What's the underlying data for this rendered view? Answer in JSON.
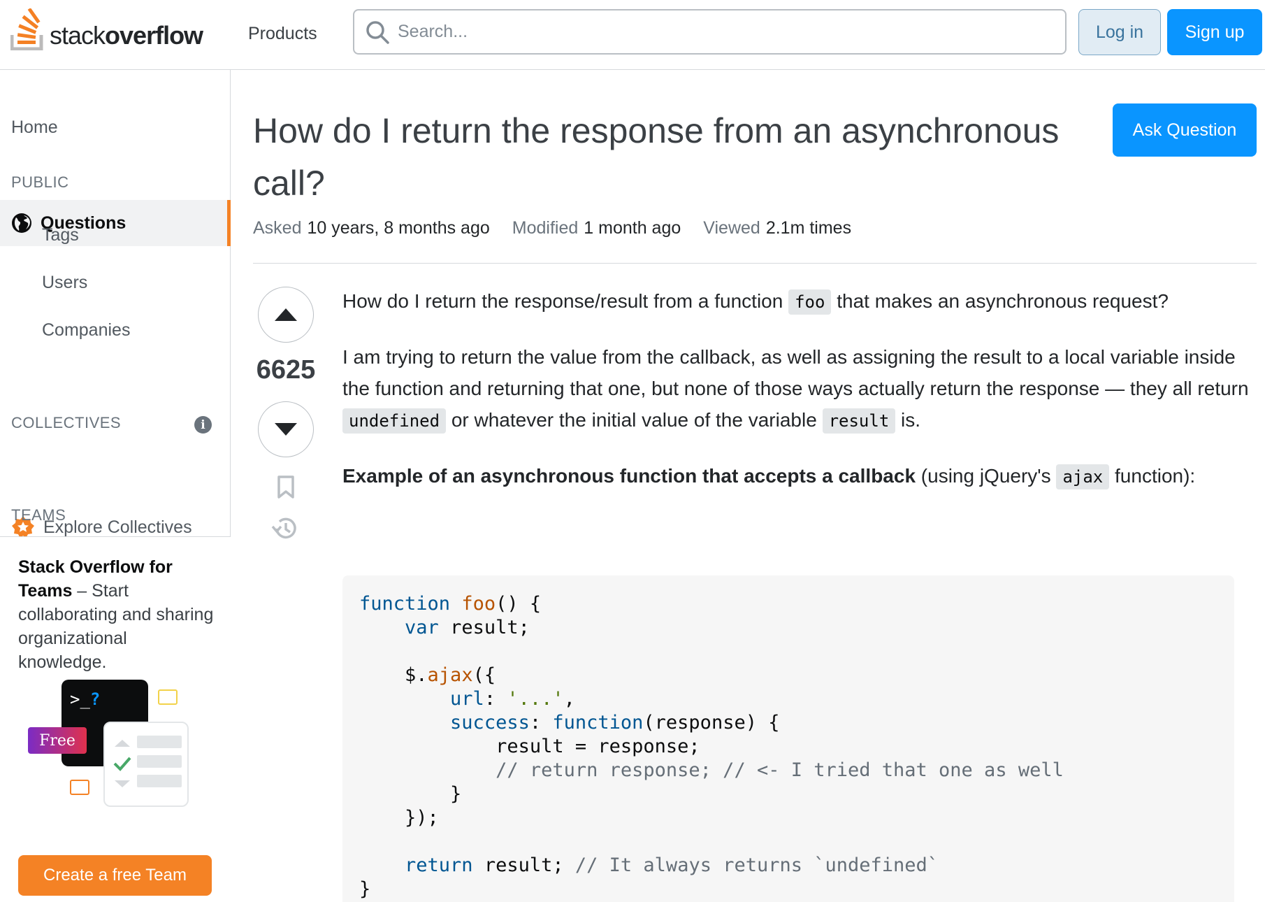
{
  "header": {
    "logo_text_light": "stack",
    "logo_text_bold": "overflow",
    "products_label": "Products",
    "search_placeholder": "Search...",
    "login_label": "Log in",
    "signup_label": "Sign up"
  },
  "sidebar": {
    "home": "Home",
    "public_heading": "PUBLIC",
    "questions": "Questions",
    "tags": "Tags",
    "users": "Users",
    "companies": "Companies",
    "collectives_heading": "COLLECTIVES",
    "explore_collectives": "Explore Collectives",
    "teams_heading": "TEAMS",
    "teams_promo_bold": "Stack Overflow for Teams",
    "teams_promo_text": " – Start collaborating and sharing organizational knowledge.",
    "terminal_prompt": ">_",
    "terminal_q": "?",
    "free_badge": "Free",
    "create_team_button": "Create a free Team",
    "colors": {
      "accent": "#f48225",
      "active_bg": "#f1f2f3"
    }
  },
  "question": {
    "title": "How do I return the response from an asynchronous call?",
    "ask_button": "Ask Question",
    "asked_label": "Asked",
    "asked_value": "10 years, 8 months ago",
    "modified_label": "Modified",
    "modified_value": "1 month ago",
    "viewed_label": "Viewed",
    "viewed_value": "2.1m times",
    "score": "6625",
    "p1_before": "How do I return the response/result from a function ",
    "p1_code": "foo",
    "p1_after": " that makes an asynchronous request?",
    "p2_before": "I am trying to return the value from the callback, as well as assigning the result to a local variable inside the function and returning that one, but none of those ways actually return the response — they all return ",
    "p2_code1": "undefined",
    "p2_mid": " or whatever the initial value of the variable ",
    "p2_code2": "result",
    "p2_after": " is.",
    "p3_bold": "Example of an asynchronous function that accepts a callback",
    "p3_before": " (using jQuery's ",
    "p3_code": "ajax",
    "p3_after": " function):"
  },
  "code": {
    "l1_kw": "function",
    "l1_fn": "foo",
    "l1_rest": "() {",
    "l2_kw": "var",
    "l2_rest": " result;",
    "l4_a": "$.",
    "l4_fn": "ajax",
    "l4_b": "({",
    "l5_prop": "url",
    "l5_b": ": ",
    "l5_str": "'...'",
    "l5_c": ",",
    "l6_prop": "success",
    "l6_b": ": ",
    "l6_kw": "function",
    "l6_c": "(response) {",
    "l7": "result = response;",
    "l8_cm": "// return response; // <- I tried that one as well",
    "l9": "}",
    "l10": "});",
    "l12_kw": "return",
    "l12_b": " result; ",
    "l12_cm": "// It always returns `undefined`",
    "l13": "}"
  },
  "icons": {
    "logo": "stackoverflow-logo-icon",
    "search": "search-icon",
    "globe": "globe-icon",
    "info": "info-icon",
    "collectives": "collectives-icon",
    "upvote": "upvote-arrow-icon",
    "downvote": "downvote-arrow-icon",
    "bookmark": "bookmark-icon",
    "history": "history-icon"
  }
}
